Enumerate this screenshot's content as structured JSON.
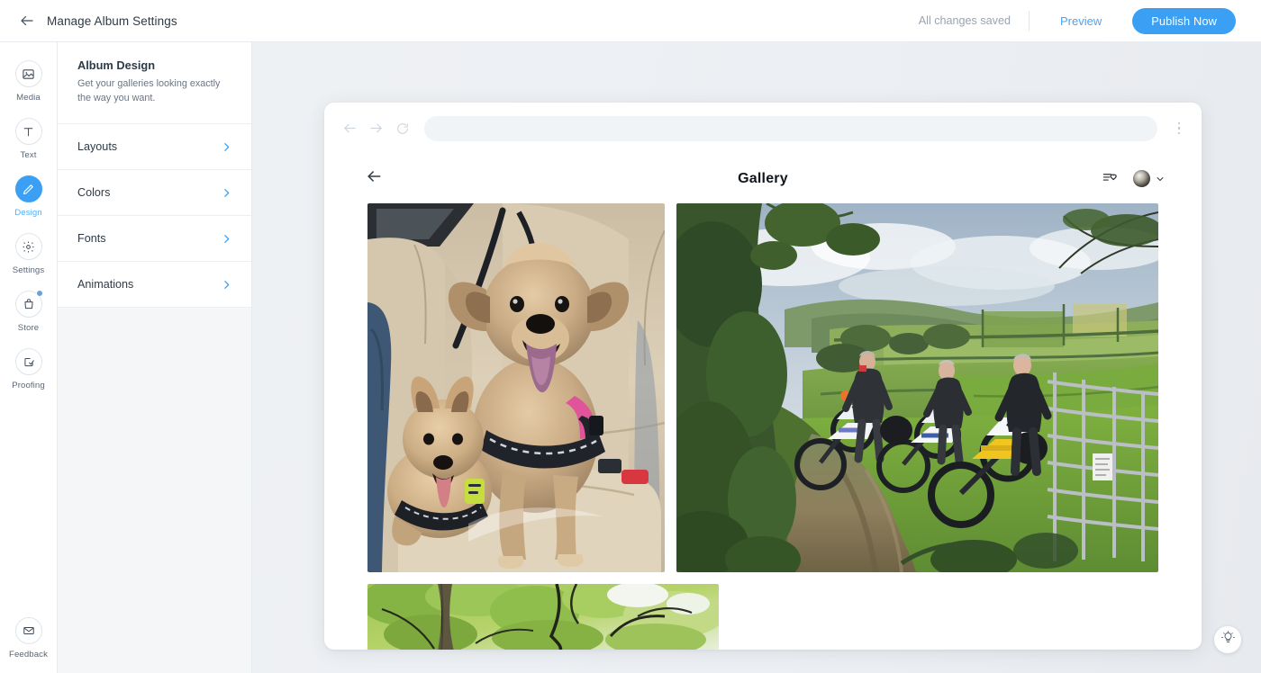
{
  "topbar": {
    "back_icon": "arrow-left-icon",
    "title": "Manage Album Settings",
    "save_status": "All changes saved",
    "preview_label": "Preview",
    "publish_label": "Publish Now",
    "accent_color": "#3ba0f3",
    "link_color": "#4da3f5"
  },
  "rail": {
    "items": [
      {
        "label": "Media",
        "icon": "image-icon",
        "active": false,
        "badge": false
      },
      {
        "label": "Text",
        "icon": "text-t-icon",
        "active": false,
        "badge": false
      },
      {
        "label": "Design",
        "icon": "pencil-icon",
        "active": true,
        "badge": false
      },
      {
        "label": "Settings",
        "icon": "gear-icon",
        "active": false,
        "badge": false
      },
      {
        "label": "Store",
        "icon": "shopping-bag-icon",
        "active": false,
        "badge": true
      },
      {
        "label": "Proofing",
        "icon": "check-square-icon",
        "active": false,
        "badge": false
      }
    ],
    "bottom": {
      "label": "Feedback",
      "icon": "envelope-icon"
    }
  },
  "panel": {
    "heading": "Album Design",
    "subheading": "Get your galleries looking exactly the way you want.",
    "rows": [
      {
        "label": "Layouts",
        "chevron": "chevron-right-icon"
      },
      {
        "label": "Colors",
        "chevron": "chevron-right-icon"
      },
      {
        "label": "Fonts",
        "chevron": "chevron-right-icon"
      },
      {
        "label": "Animations",
        "chevron": "chevron-right-icon"
      }
    ]
  },
  "preview": {
    "browser": {
      "back_icon": "arrow-left-icon",
      "forward_icon": "arrow-right-icon",
      "reload_icon": "reload-icon",
      "url_value": "",
      "url_placeholder": "",
      "menu_icon": "kebab-menu-icon"
    },
    "gallery": {
      "back_icon": "arrow-left-icon",
      "title": "Gallery",
      "favorites_icon": "list-heart-icon",
      "avatar": "user-avatar",
      "account_chevron": "chevron-down-icon",
      "photos": [
        {
          "alt": "Two yorkshire terrier dogs sitting on a car back seat"
        },
        {
          "alt": "Three riders with off-road motorbikes on a grassy countryside track"
        },
        {
          "alt": "Green tree canopy seen from below"
        }
      ]
    },
    "hint_icon": "lightbulb-icon"
  }
}
